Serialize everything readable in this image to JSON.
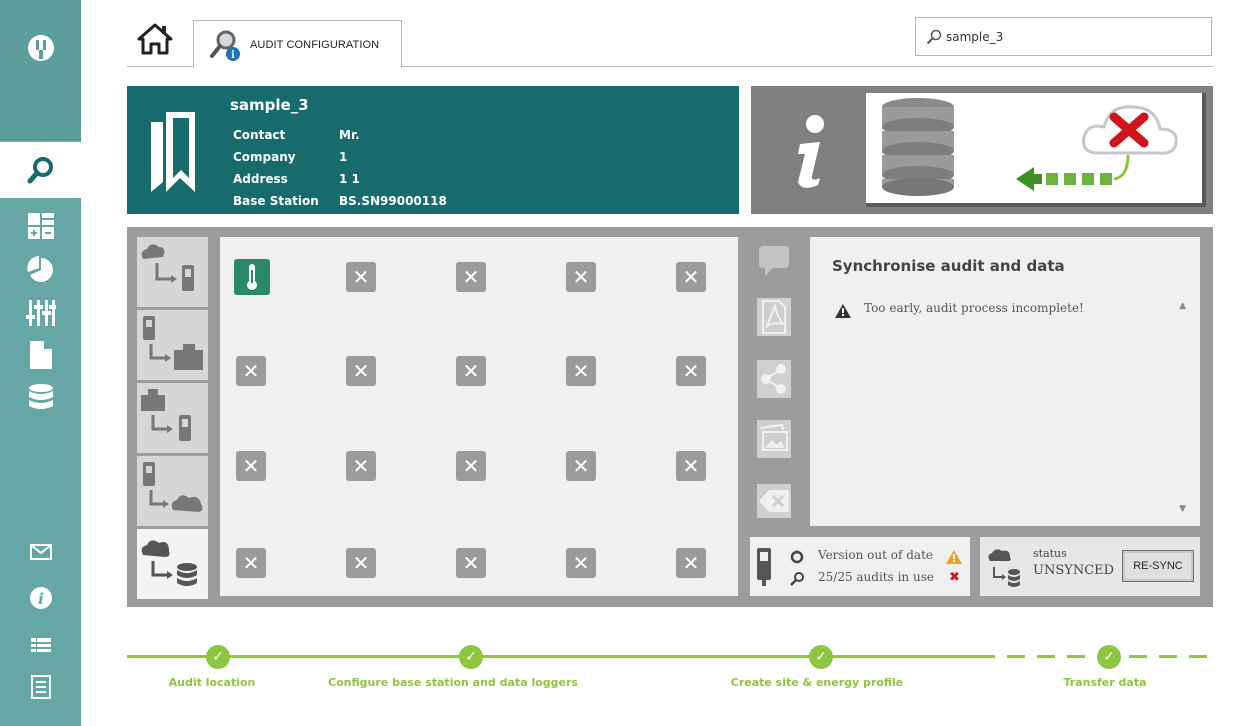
{
  "topbar": {
    "tab_label": "AUDIT CONFIGURATION",
    "search_value": "sample_3"
  },
  "site": {
    "name": "sample_3",
    "fields": [
      {
        "key": "Contact",
        "value": "Mr."
      },
      {
        "key": "Company",
        "value": "1"
      },
      {
        "key": "Address",
        "value": "1 1"
      },
      {
        "key": "Base Station",
        "value": "BS.SN99000118"
      }
    ]
  },
  "messages": {
    "heading": "Synchronise audit and data",
    "warning": "Too early, audit process incomplete!"
  },
  "version": {
    "line1": "Version out of date",
    "line2": "25/25 audits in use"
  },
  "status": {
    "label": "status",
    "value": "UNSYNCED",
    "resync_label": "RE-SYNC"
  },
  "progress": {
    "steps": [
      {
        "label": "Audit location"
      },
      {
        "label": "Configure base station and data loggers"
      },
      {
        "label": "Create site & energy profile"
      },
      {
        "label": "Transfer data"
      }
    ]
  },
  "colors": {
    "sidebar": "#66a6a5",
    "banner": "#176b6c",
    "accent_green": "#8dc63f",
    "panel_gray": "#9c9c9c"
  },
  "icons": {
    "sidebar_top": "plug-logo-icon",
    "sidebar": [
      "search-icon",
      "calculator-icon",
      "pie-chart-icon",
      "sliders-icon",
      "document-icon",
      "database-icon"
    ],
    "sidebar_bottom": [
      "mail-icon",
      "info-icon",
      "list-icon",
      "report-icon"
    ]
  }
}
